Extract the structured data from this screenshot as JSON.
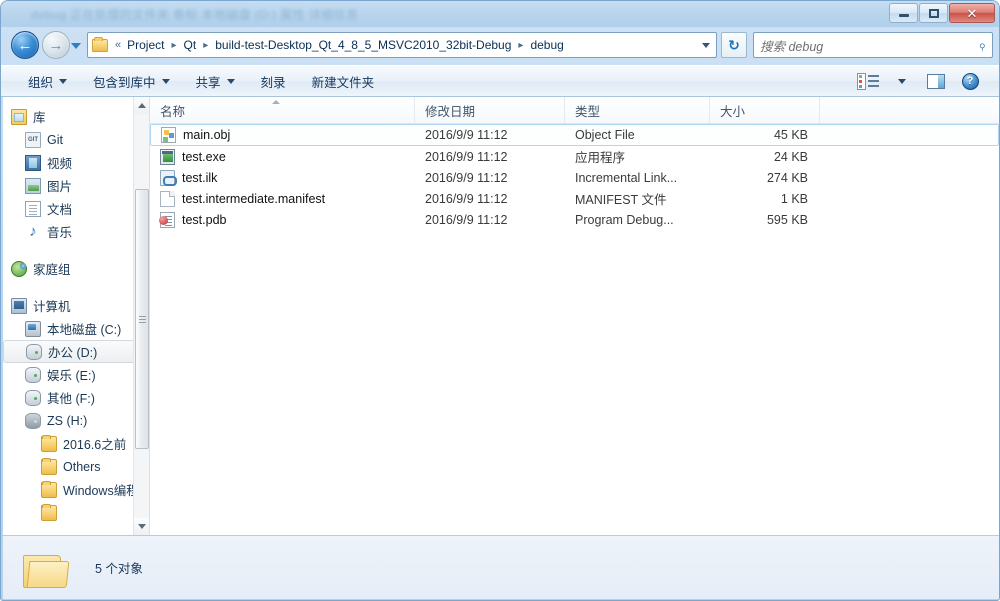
{
  "window": {
    "title": "debug 正在处理的文件夹 卷标 本地磁盘 (D:) 属性 详细信息",
    "controls": {
      "minimize": "–",
      "maximize": "❐",
      "close": "✕"
    }
  },
  "navigation": {
    "back_label": "◀",
    "forward_label": "▶",
    "recent_label": "▾",
    "refresh_label": "↻",
    "breadcrumb": {
      "overflow": "«",
      "separator": "▸",
      "segments": [
        "Project",
        "Qt",
        "build-test-Desktop_Qt_4_8_5_MSVC2010_32bit-Debug",
        "debug"
      ]
    },
    "address_dropdown": "▾"
  },
  "search": {
    "placeholder": "搜索 debug",
    "icon": "search-icon"
  },
  "toolbar": {
    "items": [
      {
        "label": "组织",
        "has_caret": true
      },
      {
        "label": "包含到库中",
        "has_caret": true
      },
      {
        "label": "共享",
        "has_caret": true
      },
      {
        "label": "刻录",
        "has_caret": false
      },
      {
        "label": "新建文件夹",
        "has_caret": false
      }
    ],
    "right_icons": [
      "view-options-icon",
      "view-dropdown-caret",
      "preview-pane-icon",
      "help-icon"
    ],
    "help_glyph": "?"
  },
  "sidebar": {
    "groups": [
      {
        "header": {
          "label": "库",
          "icon": "library-icon"
        },
        "items": [
          {
            "label": "Git",
            "icon": "git-icon",
            "selected": false
          },
          {
            "label": "视频",
            "icon": "video-icon",
            "selected": false
          },
          {
            "label": "图片",
            "icon": "pictures-icon",
            "selected": false
          },
          {
            "label": "文档",
            "icon": "documents-icon",
            "selected": false
          },
          {
            "label": "音乐",
            "icon": "music-icon",
            "selected": false
          }
        ]
      },
      {
        "header": {
          "label": "家庭组",
          "icon": "homegroup-icon"
        },
        "items": []
      },
      {
        "header": {
          "label": "计算机",
          "icon": "computer-icon"
        },
        "items": [
          {
            "label": "本地磁盘 (C:)",
            "icon": "system-drive-icon",
            "selected": false
          },
          {
            "label": "办公 (D:)",
            "icon": "drive-icon",
            "selected": true
          },
          {
            "label": "娱乐 (E:)",
            "icon": "drive-icon",
            "selected": false
          },
          {
            "label": "其他 (F:)",
            "icon": "drive-icon",
            "selected": false
          },
          {
            "label": "ZS (H:)",
            "icon": "removable-drive-icon",
            "selected": false
          },
          {
            "label": "2016.6之前",
            "icon": "folder-icon",
            "selected": false,
            "level": 2
          },
          {
            "label": "Others",
            "icon": "folder-icon",
            "selected": false,
            "level": 2
          },
          {
            "label": "Windows编程",
            "icon": "folder-icon",
            "selected": false,
            "level": 2
          }
        ]
      }
    ],
    "scrollbar": {
      "up": "▲",
      "down": "▼"
    }
  },
  "filelist": {
    "columns": [
      {
        "key": "name",
        "label": "名称",
        "sorted": "asc"
      },
      {
        "key": "date",
        "label": "修改日期",
        "sorted": null
      },
      {
        "key": "type",
        "label": "类型",
        "sorted": null
      },
      {
        "key": "size",
        "label": "大小",
        "sorted": null
      }
    ],
    "rows": [
      {
        "name": "main.obj",
        "date": "2016/9/9 11:12",
        "type": "Object File",
        "size": "45 KB",
        "icon": "object-file-icon",
        "focused": true
      },
      {
        "name": "test.exe",
        "date": "2016/9/9 11:12",
        "type": "应用程序",
        "size": "24 KB",
        "icon": "application-icon",
        "focused": false
      },
      {
        "name": "test.ilk",
        "date": "2016/9/9 11:12",
        "type": "Incremental Link...",
        "size": "274 KB",
        "icon": "link-file-icon",
        "focused": false
      },
      {
        "name": "test.intermediate.manifest",
        "date": "2016/9/9 11:12",
        "type": "MANIFEST 文件",
        "size": "1 KB",
        "icon": "blank-document-icon",
        "focused": false
      },
      {
        "name": "test.pdb",
        "date": "2016/9/9 11:12",
        "type": "Program Debug...",
        "size": "595 KB",
        "icon": "program-database-icon",
        "focused": false
      }
    ]
  },
  "statusbar": {
    "icon": "folder-icon",
    "text": "5 个对象"
  },
  "colors": {
    "titlebar": "#b7d4ec",
    "selection_border": "#b3d6f0",
    "accent_blue": "#2f7ec4",
    "folder_yellow": "#f7d273",
    "close_red": "#c95246"
  }
}
